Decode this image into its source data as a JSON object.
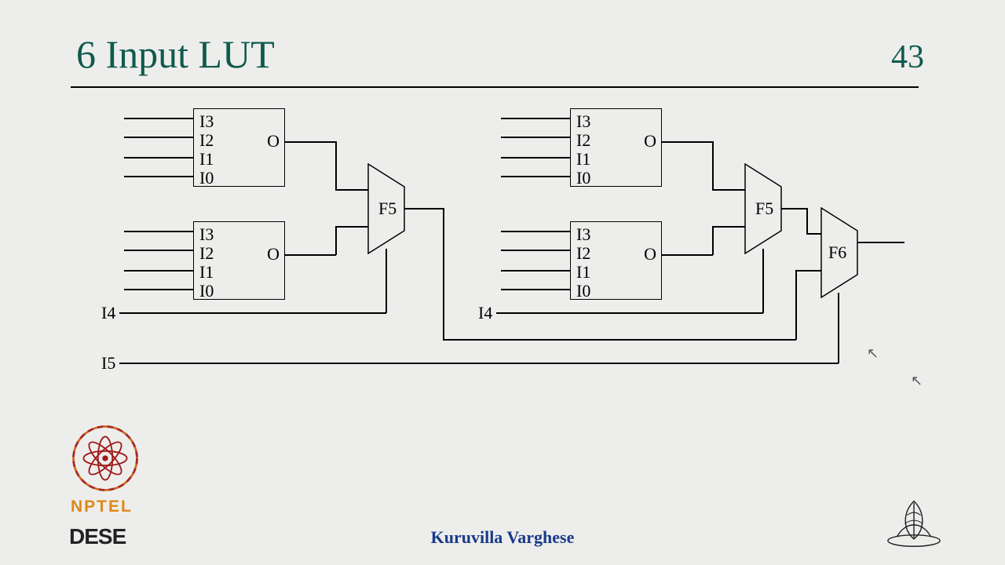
{
  "header": {
    "title": "6 Input LUT",
    "page_number": "43"
  },
  "lut_labels": {
    "inputs": [
      "I3",
      "I2",
      "I1",
      "I0"
    ],
    "output": "O"
  },
  "mux": {
    "f5": "F5",
    "f6": "F6"
  },
  "select_lines": {
    "i4": "I4",
    "i5": "I5"
  },
  "footer": {
    "author": "Kuruvilla Varghese",
    "nptel": "NPTEL",
    "dese": "DESE"
  }
}
